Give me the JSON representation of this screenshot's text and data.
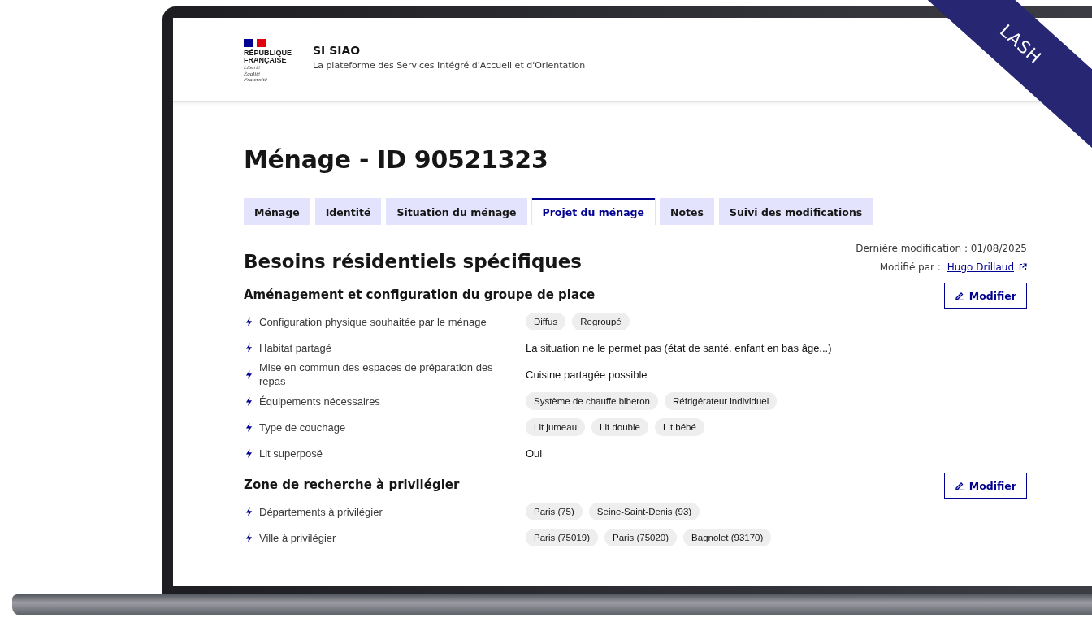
{
  "header": {
    "logo_lines": [
      "RÉPUBLIQUE",
      "FRANÇAISE"
    ],
    "motto": [
      "Liberté",
      "Égalité",
      "Fraternité"
    ],
    "title": "SI SIAO",
    "subtitle": "La plateforme des Services Intégré d'Accueil et d'Orientation"
  },
  "page_title": "Ménage - ID 90521323",
  "tabs": [
    {
      "label": "Ménage",
      "selected": false
    },
    {
      "label": "Identité",
      "selected": false
    },
    {
      "label": "Situation du ménage",
      "selected": false
    },
    {
      "label": "Projet du ménage",
      "selected": true
    },
    {
      "label": "Notes",
      "selected": false
    },
    {
      "label": "Suivi des modifications",
      "selected": false
    }
  ],
  "section_title": "Besoins résidentiels spécifiques",
  "meta": {
    "last_modified": "Dernière modification : 01/08/2025",
    "modified_by_label": "Modifié par :",
    "modified_by": "Hugo Drillaud"
  },
  "groups": [
    {
      "title": "Aménagement et configuration du groupe de place",
      "button": "Modifier",
      "rows": [
        {
          "label": "Configuration physique souhaitée par le ménage",
          "kind": "tags",
          "tags": [
            "Diffus",
            "Regroupé"
          ]
        },
        {
          "label": "Habitat partagé",
          "kind": "text",
          "value": "La situation ne le permet pas (état de santé, enfant en bas âge...)"
        },
        {
          "label": "Mise en commun des espaces de préparation des repas",
          "kind": "text",
          "value": "Cuisine partagée possible"
        },
        {
          "label": "Équipements nécessaires",
          "kind": "tags",
          "tags": [
            "Système de chauffe biberon",
            "Réfrigérateur individuel"
          ]
        },
        {
          "label": "Type de couchage",
          "kind": "tags",
          "tags": [
            "Lit jumeau",
            "Lit double",
            "Lit bébé"
          ]
        },
        {
          "label": "Lit superposé",
          "kind": "text",
          "value": "Oui"
        }
      ]
    },
    {
      "title": "Zone de recherche à privilégier",
      "button": "Modifier",
      "rows": [
        {
          "label": "Départements à privilégier",
          "kind": "tags",
          "tags": [
            "Paris (75)",
            "Seine-Saint-Denis (93)"
          ]
        },
        {
          "label": "Ville à privilégier",
          "kind": "tags",
          "tags": [
            "Paris (75019)",
            "Paris (75020)",
            "Bagnolet (93170)"
          ]
        }
      ]
    }
  ],
  "ribbon": "LASH"
}
